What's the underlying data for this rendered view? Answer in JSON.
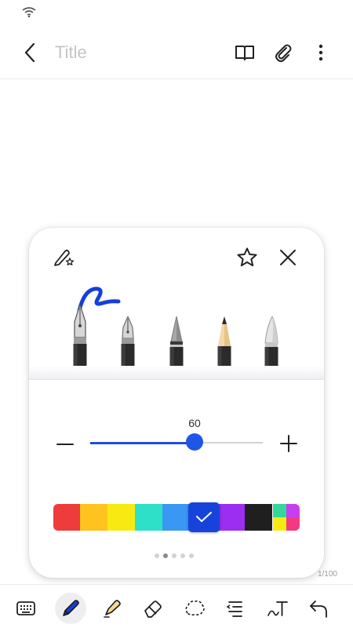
{
  "header": {
    "title_placeholder": "Title"
  },
  "pen_panel": {
    "pens": [
      "fountain-pen",
      "calligraphy-pen",
      "brush-pen",
      "pencil",
      "marker-pen"
    ],
    "selected_pen": "fountain-pen",
    "stroke_color": "#1440d8",
    "size": {
      "value": "60",
      "min": 0,
      "max": 100,
      "fraction": 0.6
    },
    "palette": {
      "colors": [
        "#ee3b3b",
        "#ffc21f",
        "#f7ea13",
        "#2ee0c7",
        "#3a97f3",
        "#1843db",
        "#9b2ef0",
        "#1f1f1f"
      ],
      "selected_color": "#1843db",
      "multi_color": [
        "#35d69b",
        "#c63ef0",
        "#f7ea13",
        "#f23a80"
      ]
    },
    "page_indicator": {
      "pages": 5,
      "current": 2
    }
  },
  "page_count": "1/100",
  "bottom_toolbar": {
    "tools": [
      "keyboard-icon",
      "pen-icon",
      "highlighter-icon",
      "eraser-icon",
      "lasso-icon",
      "text-align-icon",
      "text-convert-icon",
      "undo-icon"
    ],
    "active_tool": "pen-icon"
  }
}
